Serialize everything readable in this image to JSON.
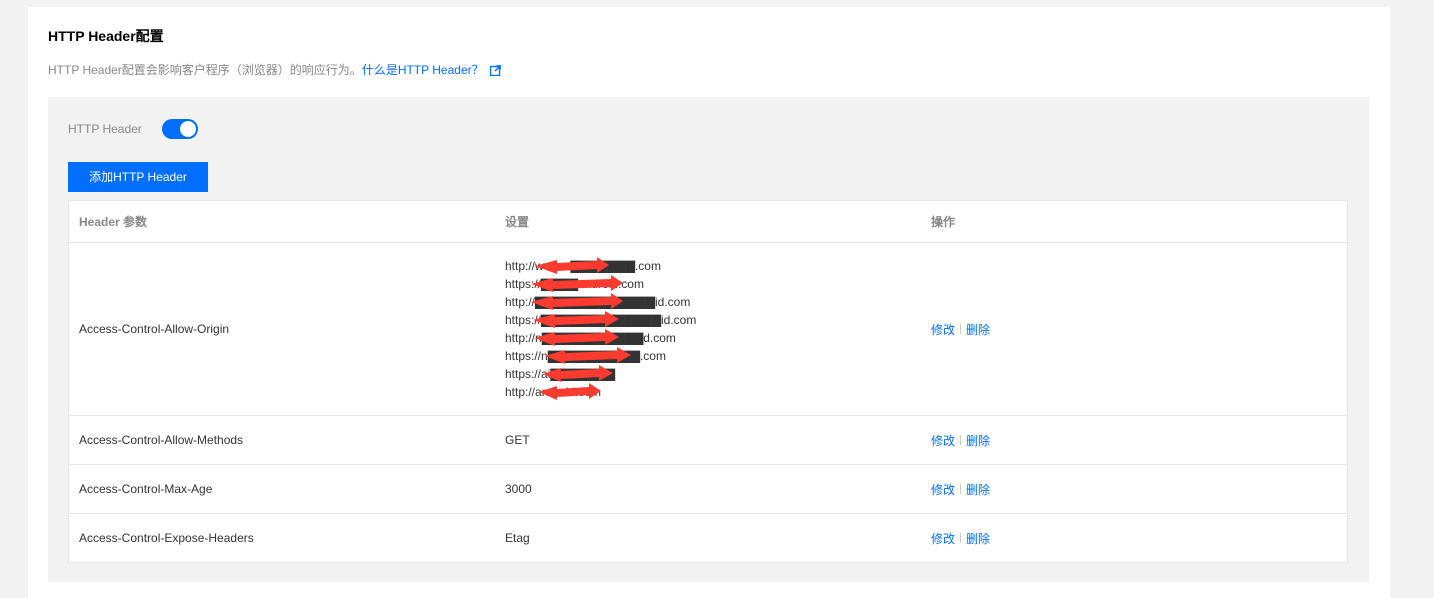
{
  "section": {
    "title": "HTTP Header配置",
    "description": "HTTP Header配置会影响客户程序（浏览器）的响应行为。",
    "help_link": "什么是HTTP Header？"
  },
  "switch": {
    "label": "HTTP Header",
    "enabled": true
  },
  "add_button": "添加HTTP Header",
  "table": {
    "columns": [
      "Header 参数",
      "设置",
      "操作"
    ],
    "rows": [
      {
        "param": "Access-Control-Allow-Origin",
        "values": [
          "http://www.a▇▇▇▇▇▇▇.com",
          "https://▇▇▇▇android.com",
          "http://▇▇▇▇▇▇▇▇▇▇▇▇▇id.com",
          "https://▇▇▇▇▇▇▇▇▇▇▇▇▇id.com",
          "http://n▇▇▇▇▇▇▇▇▇▇▇d.com",
          "https://n▇▇▇▇▇▇▇▇▇▇.com",
          "https://ai▇▇▇▇▇▇▇",
          "http://android.com"
        ],
        "edit": "修改",
        "delete": "删除"
      },
      {
        "param": "Access-Control-Allow-Methods",
        "value": "GET",
        "edit": "修改",
        "delete": "删除"
      },
      {
        "param": "Access-Control-Max-Age",
        "value": "3000",
        "edit": "修改",
        "delete": "删除"
      },
      {
        "param": "Access-Control-Expose-Headers",
        "value": "Etag",
        "edit": "修改",
        "delete": "删除"
      }
    ]
  },
  "colors": {
    "accent": "#006eff",
    "redaction": "#ff3b30",
    "panel_bg": "#f2f2f2"
  }
}
